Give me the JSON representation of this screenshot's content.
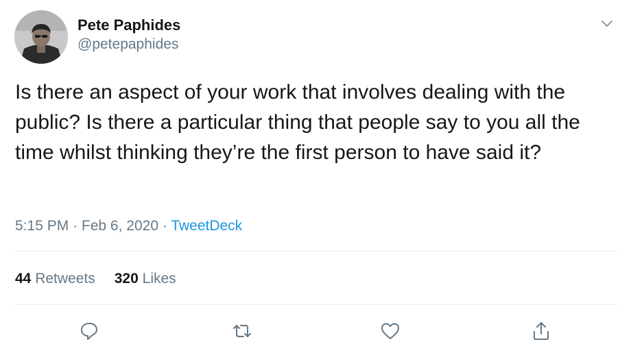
{
  "author": {
    "display_name": "Pete Paphides",
    "handle": "@petepaphides"
  },
  "tweet": {
    "text": "Is there an aspect of your work that involves dealing with the public? Is there a particular thing that people say to you all the time whilst thinking they’re the first person to have said it?",
    "time": "5:15 PM",
    "separator": "·",
    "date": "Feb 6, 2020",
    "source": "TweetDeck"
  },
  "stats": {
    "retweets_count": "44",
    "retweets_label": "Retweets",
    "likes_count": "320",
    "likes_label": "Likes"
  },
  "icons": {
    "menu": "chevron-down-icon",
    "reply": "reply-icon",
    "retweet": "retweet-icon",
    "like": "heart-icon",
    "share": "share-icon"
  },
  "colors": {
    "text": "#14171a",
    "secondary": "#657786",
    "link": "#1b95e0",
    "divider": "#e6ecf0"
  }
}
